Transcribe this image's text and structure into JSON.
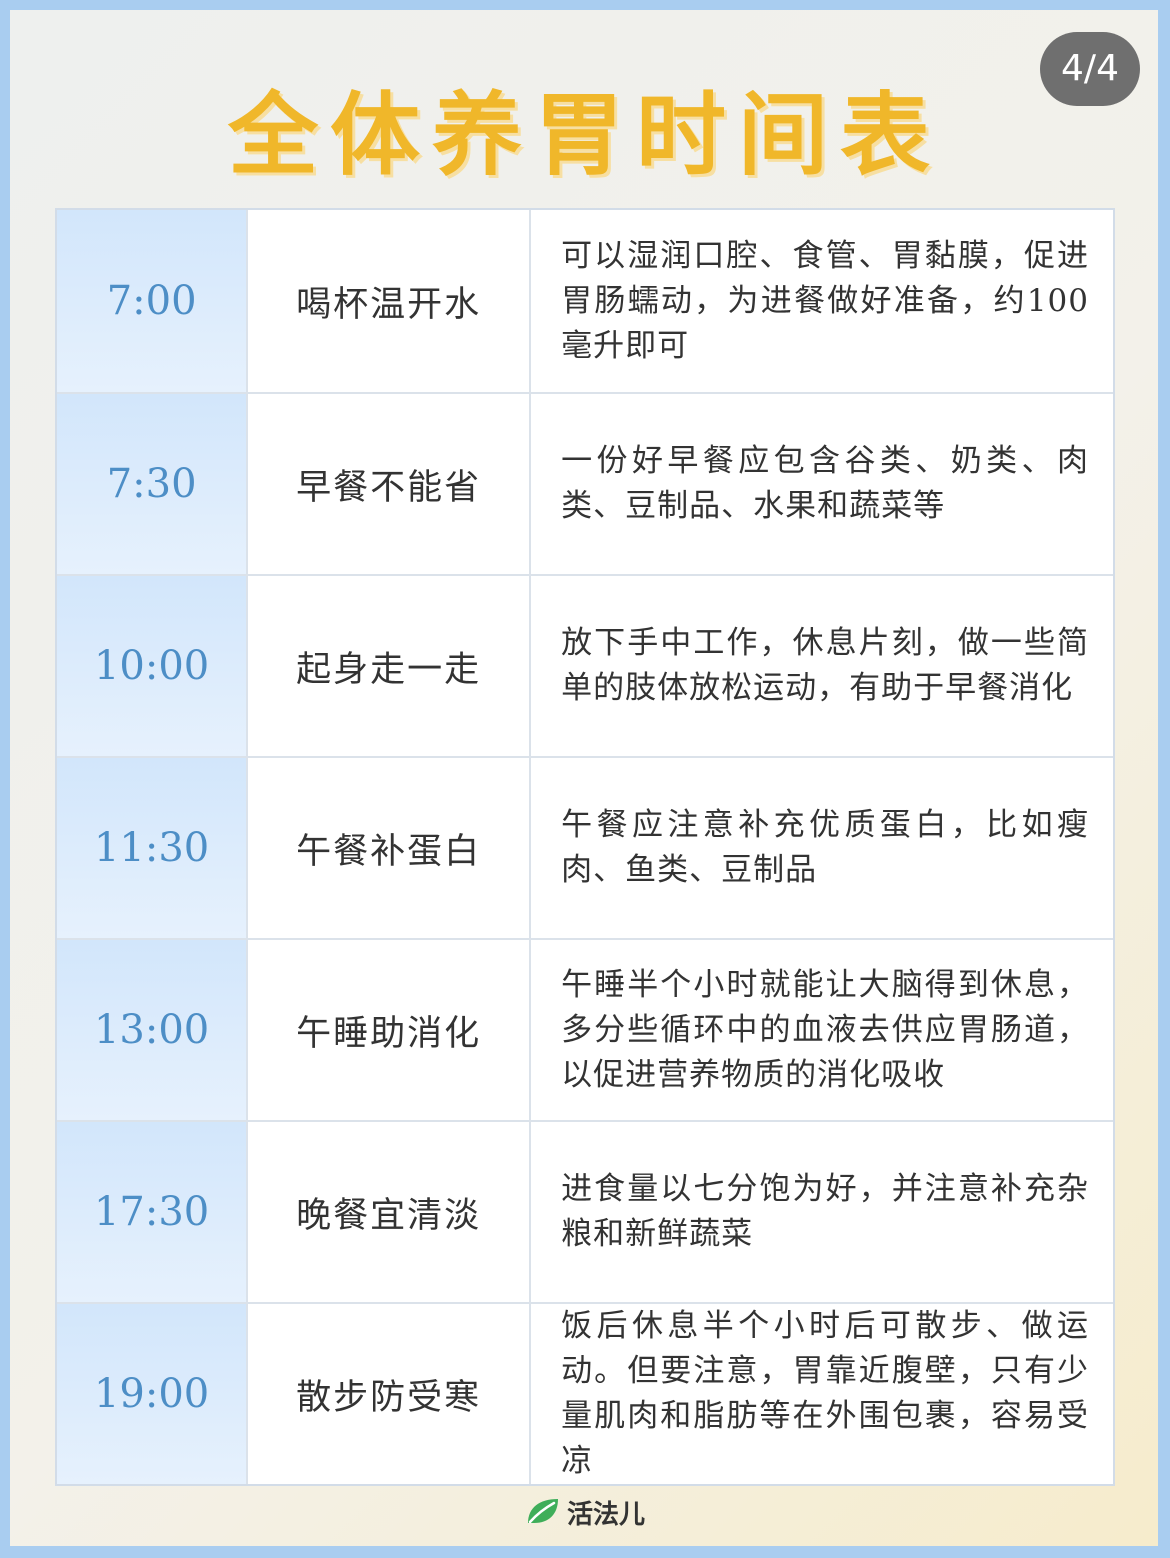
{
  "header": {
    "title": "全体养胃时间表",
    "page_indicator": "4/4"
  },
  "schedule": [
    {
      "time": "7:00",
      "item": "喝杯温开水",
      "desc": "可以湿润口腔、食管、胃黏膜，促进胃肠蠕动，为进餐做好准备，约100毫升即可"
    },
    {
      "time": "7:30",
      "item": "早餐不能省",
      "desc": "一份好早餐应包含谷类、奶类、肉类、豆制品、水果和蔬菜等"
    },
    {
      "time": "10:00",
      "item": "起身走一走",
      "desc": "放下手中工作，休息片刻，做一些简单的肢体放松运动，有助于早餐消化"
    },
    {
      "time": "11:30",
      "item": "午餐补蛋白",
      "desc": "午餐应注意补充优质蛋白，比如瘦肉、鱼类、豆制品"
    },
    {
      "time": "13:00",
      "item": "午睡助消化",
      "desc": "午睡半个小时就能让大脑得到休息，多分些循环中的血液去供应胃肠道，以促进营养物质的消化吸收"
    },
    {
      "time": "17:30",
      "item": "晚餐宜清淡",
      "desc": "进食量以七分饱为好，并注意补充杂粮和新鲜蔬菜"
    },
    {
      "time": "19:00",
      "item": "散步防受寒",
      "desc": "饭后休息半个小时后可散步、做运动。但要注意，胃靠近腹壁，只有少量肌肉和脂肪等在外围包裹，容易受凉"
    }
  ],
  "footer": {
    "brand": "活法儿",
    "logo_icon": "leaf-icon"
  },
  "colors": {
    "title": "#f0b72a",
    "time_text": "#4d8ec6",
    "time_bg": "#d2e6fb",
    "frame": "#a9cdf0",
    "badge_bg": "#6f6f6f",
    "logo_green": "#3fae5a"
  }
}
